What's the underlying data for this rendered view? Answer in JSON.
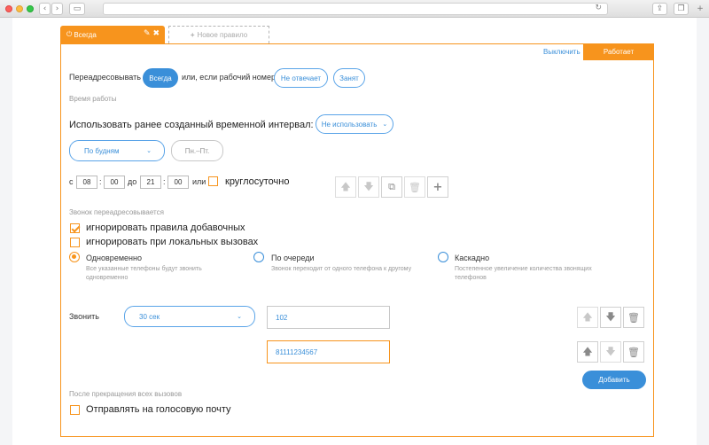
{
  "tabs": {
    "active_label": "Всегда",
    "new_label": "Новое правило"
  },
  "header": {
    "disable_link": "Выключить",
    "status": "Работает"
  },
  "forward": {
    "label": "Переадресовывать",
    "mode_button": "Всегда",
    "condition_text": "или, если рабочий номер",
    "no_answer_button": "Не отвечает",
    "busy_button": "Занят"
  },
  "work_time": {
    "section_title": "Время работы",
    "interval_label": "Использовать ранее созданный временной интервал:",
    "interval_select": "Не использовать",
    "days_select": "По будням",
    "days_range": "Пн.–Пт.",
    "from_label": "с",
    "from_hour": "08",
    "from_min": "00",
    "to_label": "до",
    "to_hour": "21",
    "to_min": "00",
    "or_label": "или",
    "allday_label": "круглосуточно"
  },
  "redirect": {
    "section_title": "Звонок переадресовывается",
    "ignore_ext_label": "игнорировать правила добавочных",
    "ignore_local_label": "игнорировать при локальных вызовах",
    "modes": [
      {
        "label": "Одновременно",
        "desc": "Все указанные телефоны будут звонить одновременно"
      },
      {
        "label": "По очереди",
        "desc": "Звонок переходит от одного телефона к другому"
      },
      {
        "label": "Каскадно",
        "desc": "Постепенное увеличение количества звонящих телефонов"
      }
    ]
  },
  "ring": {
    "label": "Звонить",
    "duration_select": "30 сек",
    "phones": [
      "102",
      "81111234567"
    ],
    "add_button": "Добавить"
  },
  "after": {
    "section_title": "После прекращения всех вызовов",
    "voicemail_label": "Отправлять на голосовую почту"
  },
  "icons": {
    "chevron": "chevron-down-icon",
    "up": "arrow-up-icon",
    "down": "arrow-down-icon",
    "copy": "copy-icon",
    "delete": "trash-icon",
    "add": "plus-icon"
  },
  "colors": {
    "accent_orange": "#f7941d",
    "accent_blue": "#3a8fd9"
  }
}
